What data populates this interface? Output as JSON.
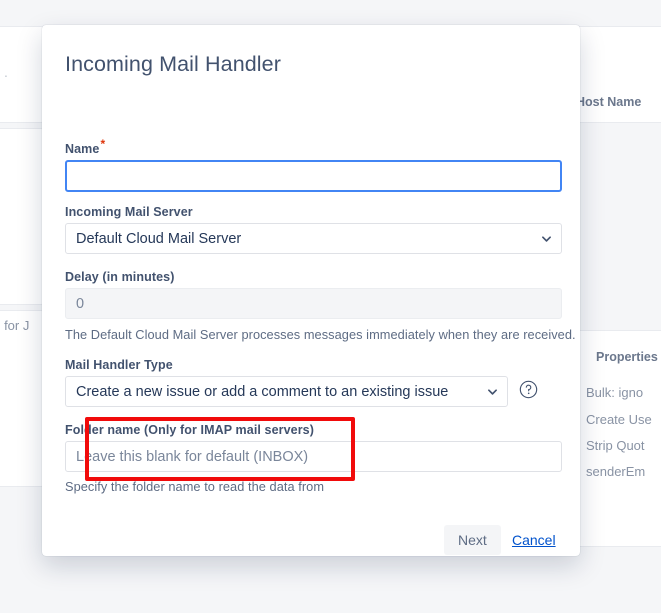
{
  "background": {
    "host_name_header": "Host Name",
    "properties_header": "Properties",
    "properties_rows": [
      "Bulk: igno",
      "Create Use",
      "Strip Quot",
      "senderEm"
    ],
    "left_row_text": "ed for J",
    "left_dot": "."
  },
  "modal": {
    "title": "Incoming Mail Handler",
    "fields": {
      "name": {
        "label": "Name",
        "required_marker": "*",
        "value": "",
        "placeholder": ""
      },
      "incoming_mail_server": {
        "label": "Incoming Mail Server",
        "selected": "Default Cloud Mail Server",
        "options": [
          "Default Cloud Mail Server"
        ]
      },
      "delay": {
        "label": "Delay (in minutes)",
        "value": "",
        "placeholder": "0",
        "disabled": true
      },
      "server_info": "The Default Cloud Mail Server processes messages immediately when they are received.",
      "mail_handler_type": {
        "label": "Mail Handler Type",
        "selected": "Create a new issue or add a comment to an existing issue",
        "options": [
          "Create a new issue or add a comment to an existing issue"
        ],
        "help_icon": "question-circle-icon"
      },
      "folder_name": {
        "label": "Folder name (Only for IMAP mail servers)",
        "value": "",
        "placeholder": "Leave this blank for default (INBOX)"
      },
      "folder_info": "Specify the folder name to read the data from"
    },
    "footer": {
      "next_label": "Next",
      "cancel_label": "Cancel"
    }
  },
  "annotation": {
    "color": "#f10b0b",
    "target": "folder-name-field"
  },
  "colors": {
    "focus_blue": "#4285f4",
    "link_blue": "#0052cc",
    "required_red": "#de350b",
    "annotation_red": "#f10b0b",
    "label_text": "#42526e",
    "helper_text": "#5e6c84",
    "page_background": "#f5f6f8"
  }
}
